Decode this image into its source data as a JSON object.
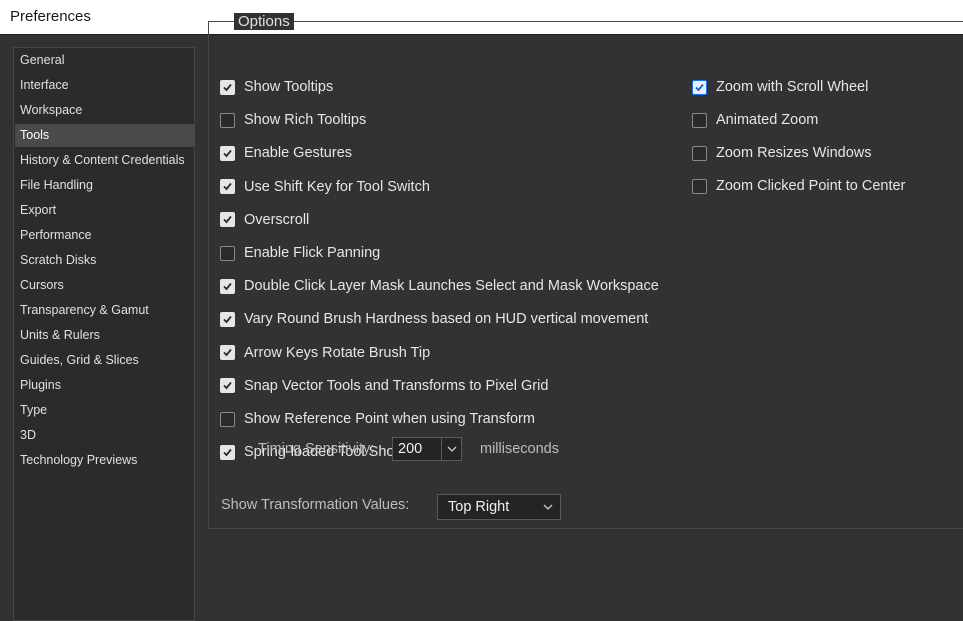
{
  "window": {
    "title": "Preferences"
  },
  "sidebar": {
    "items": [
      {
        "label": "General",
        "selected": false
      },
      {
        "label": "Interface",
        "selected": false
      },
      {
        "label": "Workspace",
        "selected": false
      },
      {
        "label": "Tools",
        "selected": true
      },
      {
        "label": "History & Content Credentials",
        "selected": false
      },
      {
        "label": "File Handling",
        "selected": false
      },
      {
        "label": "Export",
        "selected": false
      },
      {
        "label": "Performance",
        "selected": false
      },
      {
        "label": "Scratch Disks",
        "selected": false
      },
      {
        "label": "Cursors",
        "selected": false
      },
      {
        "label": "Transparency & Gamut",
        "selected": false
      },
      {
        "label": "Units & Rulers",
        "selected": false
      },
      {
        "label": "Guides, Grid & Slices",
        "selected": false
      },
      {
        "label": "Plugins",
        "selected": false
      },
      {
        "label": "Type",
        "selected": false
      },
      {
        "label": "3D",
        "selected": false
      },
      {
        "label": "Technology Previews",
        "selected": false
      }
    ]
  },
  "options": {
    "title": "Options",
    "left": [
      {
        "label": "Show Tooltips",
        "checked": true
      },
      {
        "label": "Show Rich Tooltips",
        "checked": false
      },
      {
        "label": "Enable Gestures",
        "checked": true
      },
      {
        "label": "Use Shift Key for Tool Switch",
        "checked": true
      },
      {
        "label": "Overscroll",
        "checked": true
      },
      {
        "label": "Enable Flick Panning",
        "checked": false
      },
      {
        "label": "Double Click Layer Mask Launches Select and Mask Workspace",
        "checked": true
      },
      {
        "label": "Vary Round Brush Hardness based on HUD vertical movement",
        "checked": true
      },
      {
        "label": "Arrow Keys Rotate Brush Tip",
        "checked": true
      },
      {
        "label": "Snap Vector Tools and Transforms to Pixel Grid",
        "checked": true
      },
      {
        "label": "Show Reference Point when using Transform",
        "checked": false
      },
      {
        "label": "Spring-loaded Tool Shortcuts",
        "checked": true
      }
    ],
    "right": [
      {
        "label": "Zoom with Scroll Wheel",
        "checked": true
      },
      {
        "label": "Animated Zoom",
        "checked": false
      },
      {
        "label": "Zoom Resizes Windows",
        "checked": false
      },
      {
        "label": "Zoom Clicked Point to Center",
        "checked": false
      }
    ],
    "timing": {
      "label": "Timing Sensitivity:",
      "value": "200",
      "unit": "milliseconds"
    },
    "transformation": {
      "label": "Show Transformation Values:",
      "value": "Top Right"
    }
  },
  "colors": {
    "background": "#323232",
    "sidebar": "#2b2b2b",
    "selected": "#4a4a4a",
    "focus_check": "#1a73e8"
  },
  "icons": {
    "check": "check-icon",
    "dropdown": "chevron-down-icon"
  }
}
